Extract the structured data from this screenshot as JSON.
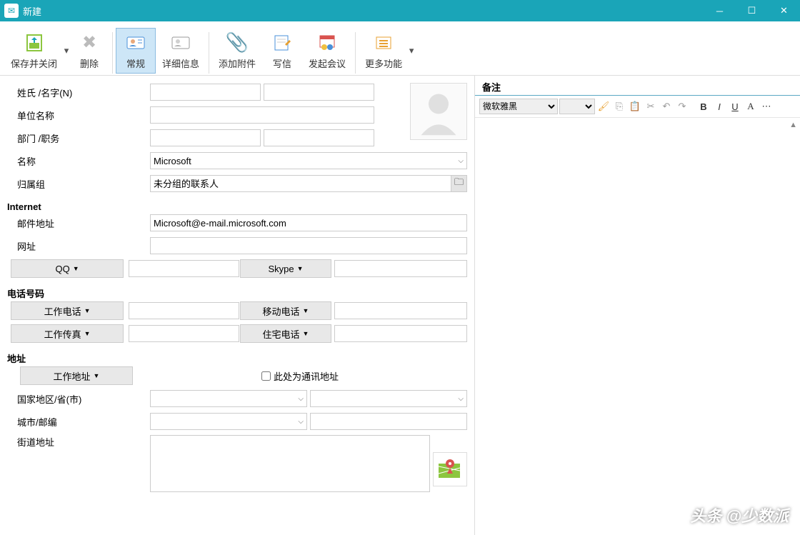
{
  "window": {
    "title": "新建"
  },
  "toolbar": {
    "save_close": "保存并关闭",
    "delete": "删除",
    "general": "常规",
    "details": "详细信息",
    "attach": "添加附件",
    "compose": "写信",
    "meeting": "发起会议",
    "more": "更多功能"
  },
  "labels": {
    "name": "姓氏 /名字(N)",
    "company": "单位名称",
    "dept_job": "部门 /职务",
    "display_name": "名称",
    "group": "归属组",
    "internet": "Internet",
    "email": "邮件地址",
    "website": "网址",
    "qq": "QQ",
    "skype": "Skype",
    "phone_section": "电话号码",
    "work_phone": "工作电话",
    "mobile": "移动电话",
    "work_fax": "工作传真",
    "home_phone": "住宅电话",
    "address_section": "地址",
    "work_addr": "工作地址",
    "mailing_addr": "此处为通讯地址",
    "country_province": "国家地区/省(市)",
    "city_zip": "城市/邮编",
    "street": "街道地址"
  },
  "values": {
    "display_name": "Microsoft",
    "group": "未分组的联系人",
    "email": "Microsoft@e-mail.microsoft.com",
    "notes_font": "微软雅黑"
  },
  "notes": {
    "title": "备注"
  },
  "watermark": "头条 @少数派"
}
